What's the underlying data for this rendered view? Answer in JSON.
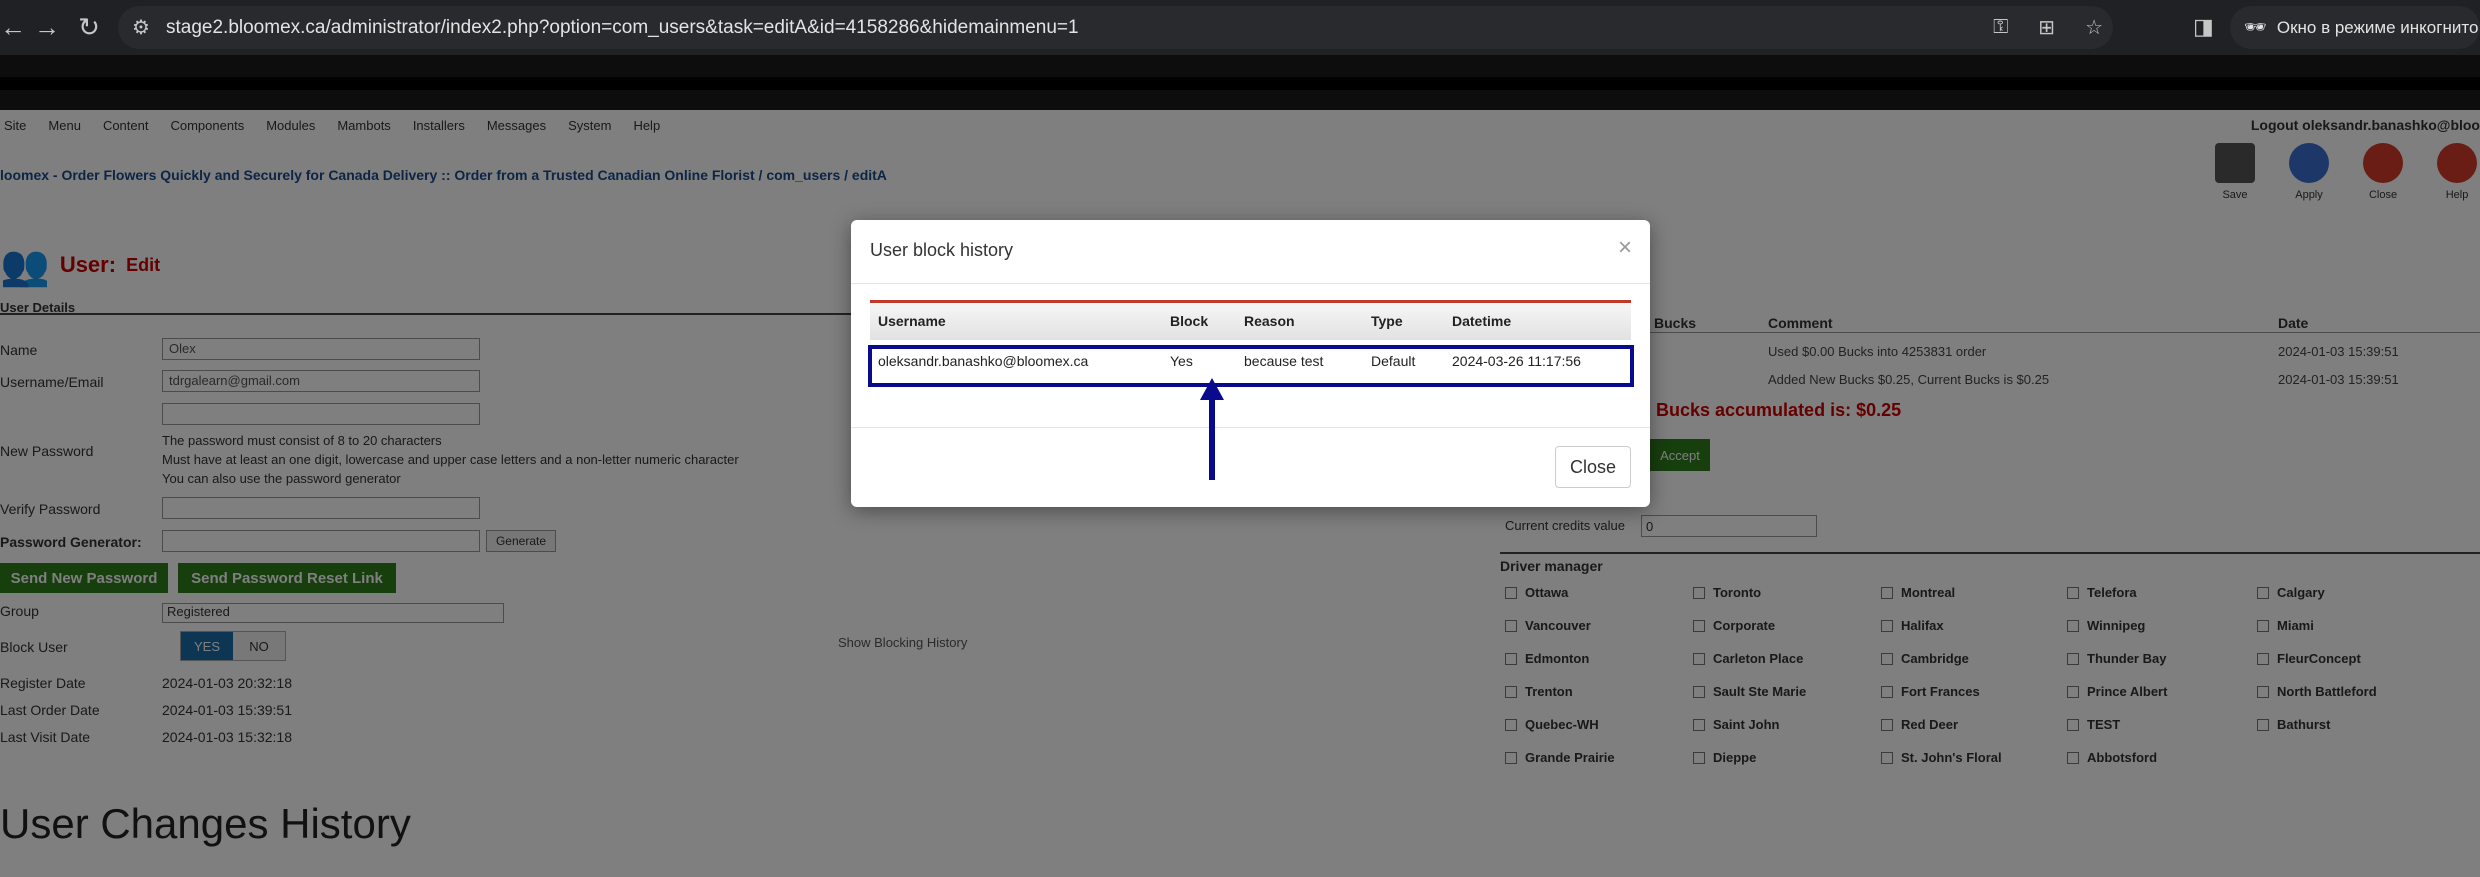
{
  "browser": {
    "url": "stage2.bloomex.ca/administrator/index2.php?option=com_users&task=editA&id=4158286&hidemainmenu=1",
    "incognito_label": "Окно в режиме инкогнито"
  },
  "header": {
    "menu": [
      "Site",
      "Menu",
      "Content",
      "Components",
      "Modules",
      "Mambots",
      "Installers",
      "Messages",
      "System",
      "Help"
    ],
    "logout": "Logout oleksandr.banashko@bloo",
    "breadcrumb": "loomex - Order Flowers Quickly and Securely for Canada Delivery :: Order from a Trusted Canadian Online Florist / com_users / editA",
    "toolbar": [
      "Save",
      "Apply",
      "Close",
      "Help"
    ]
  },
  "page": {
    "title_prefix": "User:",
    "title_suffix": "Edit",
    "section": "User Details",
    "fields": {
      "name_label": "Name",
      "name_value": "Olex",
      "email_label": "Username/Email",
      "email_value": "tdrgalearn@gmail.com",
      "new_password_label": "New Password",
      "verify_password_label": "Verify Password",
      "password_generator_label": "Password Generator:",
      "generate_label": "Generate",
      "group_label": "Group",
      "group_value": "Registered",
      "block_user_label": "Block User",
      "register_date_label": "Register Date",
      "register_date_value": "2024-01-03 20:32:18",
      "last_order_label": "Last Order Date",
      "last_order_value": "2024-01-03 15:39:51",
      "last_visit_label": "Last Visit Date",
      "last_visit_value": "2024-01-03 15:32:18"
    },
    "password_note": [
      "The password must consist of 8 to 20 characters",
      "Must have at least an one digit, lowercase and upper case letters and a non-letter numeric character",
      "You can also use the password generator"
    ],
    "send_new_password": "Send New Password",
    "send_reset_link": "Send Password Reset Link",
    "yes": "YES",
    "no": "NO",
    "show_blocking_history": "Show Blocking History",
    "user_changes_history": "User Changes History"
  },
  "bucks": {
    "headers": [
      "Bucks",
      "Comment",
      "Date"
    ],
    "rows": [
      {
        "comment": "Used $0.00 Bucks into 4253831 order",
        "date": "2024-01-03 15:39:51"
      },
      {
        "comment": "Added New Bucks $0.25, Current Bucks is $0.25",
        "date": "2024-01-03 15:39:51"
      }
    ],
    "accumulated": "Bucks accumulated is: $0.25",
    "accept": "Accept",
    "credits_label": "Current credits value",
    "credits_value": "0"
  },
  "driver_manager": {
    "title": "Driver manager",
    "cities": [
      "Ottawa",
      "Toronto",
      "Montreal",
      "Telefora",
      "Calgary",
      "Vancouver",
      "Corporate",
      "Halifax",
      "Winnipeg",
      "Miami",
      "Edmonton",
      "Carleton Place",
      "Cambridge",
      "Thunder Bay",
      "FleurConcept",
      "Trenton",
      "Sault Ste Marie",
      "Fort Frances",
      "Prince Albert",
      "North Battleford",
      "Quebec-WH",
      "Saint John",
      "Red Deer",
      "TEST",
      "Bathurst",
      "Grande Prairie",
      "Dieppe",
      "St. John's Floral",
      "Abbotsford"
    ]
  },
  "modal": {
    "title": "User block history",
    "close_x": "×",
    "columns": [
      "Username",
      "Block",
      "Reason",
      "Type",
      "Datetime"
    ],
    "row": {
      "username": "oleksandr.banashko@bloomex.ca",
      "block": "Yes",
      "reason": "because test",
      "type": "Default",
      "datetime": "2024-03-26 11:17:56"
    },
    "close_button": "Close"
  },
  "colors": {
    "highlight_border": "#0a0a8c",
    "table_top_border": "#c0392b",
    "arrow": "#0a0a8c"
  }
}
